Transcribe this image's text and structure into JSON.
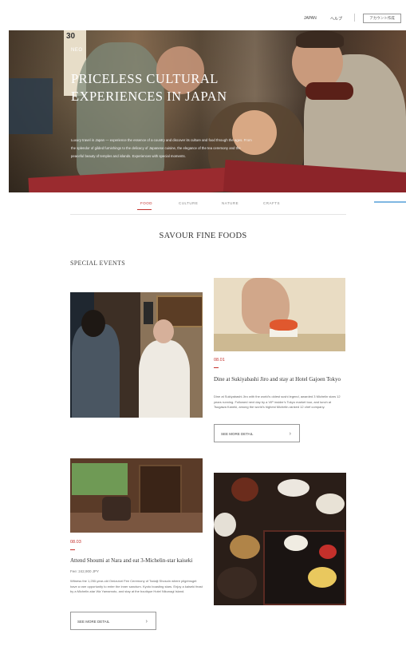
{
  "header": {
    "lang_primary": "JAPAN",
    "lang_secondary": "ヘルプ",
    "account_button": "アカウント作成"
  },
  "hero": {
    "eyebrow": "NEO",
    "title": "PRICELESS CULTURAL EXPERIENCES IN JAPAN",
    "description": "Luxury travel in Japan — experience the essence of a country and discover its culture and food through the ages. From the splendor of gilded furnishings to the delicacy of Japanese cuisine, the elegance of the tea ceremony and the peaceful beauty of temples and islands. Experiences with special moments."
  },
  "tabs": [
    {
      "label": "FOOD",
      "active": true
    },
    {
      "label": "CULTURE",
      "active": false
    },
    {
      "label": "NATURE",
      "active": false
    },
    {
      "label": "CRAFTS",
      "active": false
    }
  ],
  "main": {
    "section_title": "SAVOUR FINE FOODS",
    "sub_title": "SPECIAL EVENTS"
  },
  "events": [
    {
      "date": "08.01",
      "title": "Dine at Sukiyabashi Jiro and stay at Hotel Gajoen Tokyo",
      "sub": "",
      "description": "Dine at Sukiyabashi Jiro with the world's oldest sushi legend, awarded 3 Michelin stars 12 years running. Followed next day by a VIP insider's Tokyo market tour, and lunch at Tsugawa Kaneki, among the world's highest Michelin-ranked 12 chef company.",
      "button": "SEE MORE DETAIL"
    },
    {
      "date": "08.03",
      "title": "Attend Shoumi at Nara and eat 3-Michelin-star kaiseki",
      "sub": "Fee: 242,900 JPY",
      "description": "Witness the 1,250-year-old Omizutori Fire Ceremony of Todaiji Shosoin where pilgrimsget have a rare opportunity to enter the inner sanctum. Kyoto boasting stars. Enjoy a kaiseki feast by a Michelin-star Wa Yamamoto, and stay at the boutique Hotel Nikunagi Island.",
      "button": "SEE MORE DETAIL"
    }
  ],
  "icons": {
    "chevron": "chevron-right-icon"
  },
  "colors": {
    "accent": "#c4302b",
    "text": "#333333",
    "muted": "#888888"
  }
}
